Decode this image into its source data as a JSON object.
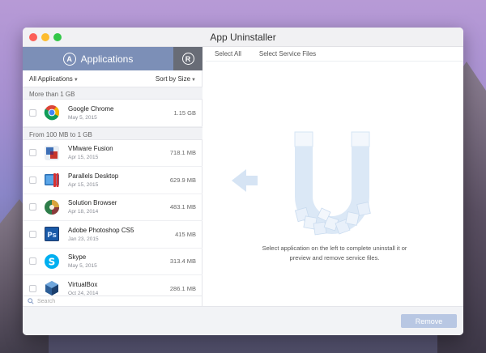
{
  "window": {
    "title": "App Uninstaller"
  },
  "sidebar": {
    "applications_tab": "Applications",
    "applications_tab_icon": "app-store-icon",
    "register_icon": "registered-icon",
    "filter": {
      "category": "All Applications",
      "sort": "Sort by Size"
    },
    "search_placeholder": "Search",
    "groups": [
      {
        "label": "More than 1 GB",
        "apps": [
          {
            "name": "Google Chrome",
            "date": "May 5, 2015",
            "size": "1.15 GB",
            "icon": "chrome-icon"
          }
        ]
      },
      {
        "label": "From 100 MB to 1 GB",
        "apps": [
          {
            "name": "VMware Fusion",
            "date": "Apr 15, 2015",
            "size": "718.1 MB",
            "icon": "vmware-icon"
          },
          {
            "name": "Parallels Desktop",
            "date": "Apr 15, 2015",
            "size": "629.9 MB",
            "icon": "parallels-icon"
          },
          {
            "name": "Solution Browser",
            "date": "Apr 18, 2014",
            "size": "483.1 MB",
            "icon": "solution-browser-icon"
          },
          {
            "name": "Adobe Photoshop CS5",
            "date": "Jan 23, 2015",
            "size": "415 MB",
            "icon": "photoshop-icon"
          },
          {
            "name": "Skype",
            "date": "May 5, 2015",
            "size": "313.4 MB",
            "icon": "skype-icon"
          },
          {
            "name": "VirtualBox",
            "date": "Oct 24, 2014",
            "size": "286.1 MB",
            "icon": "virtualbox-icon"
          }
        ]
      }
    ]
  },
  "main": {
    "tabs": [
      "Select All",
      "Select Service Files"
    ],
    "message": "Select application on the left to complete uninstall it or preview and remove service files."
  },
  "footer": {
    "remove_label": "Remove"
  },
  "colors": {
    "accent": "#7c8fb7",
    "register_bg": "#686c76",
    "remove_button": "#b8c7e3",
    "illustration": "#dbe8f6"
  }
}
